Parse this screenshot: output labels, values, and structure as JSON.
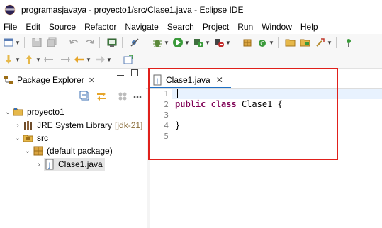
{
  "window": {
    "title": "programasjavaya - proyecto1/src/Clase1.java - Eclipse IDE",
    "app_icon": "eclipse-icon"
  },
  "menubar": {
    "items": [
      "File",
      "Edit",
      "Source",
      "Refactor",
      "Navigate",
      "Search",
      "Project",
      "Run",
      "Window",
      "Help"
    ]
  },
  "package_explorer": {
    "title": "Package Explorer",
    "close_glyph": "✕",
    "tree": {
      "project": "proyecto1",
      "jre_label": "JRE System Library",
      "jre_version": "[jdk-21]",
      "src": "src",
      "package": "(default package)",
      "file": "Clase1.java"
    }
  },
  "editor": {
    "tab_label": "Clase1.java",
    "tab_close_glyph": "✕",
    "line_numbers": [
      "1",
      "2",
      "3",
      "4",
      "5"
    ],
    "code": {
      "line2_kw1": "public",
      "line2_kw2": "class",
      "line2_rest": " Clase1 {",
      "line4": "}"
    }
  },
  "colors": {
    "keyword": "#7f0055",
    "highlight_border": "#e0201b",
    "current_line": "#e8f2fe",
    "active_tab_underline": "#1e70c6"
  }
}
